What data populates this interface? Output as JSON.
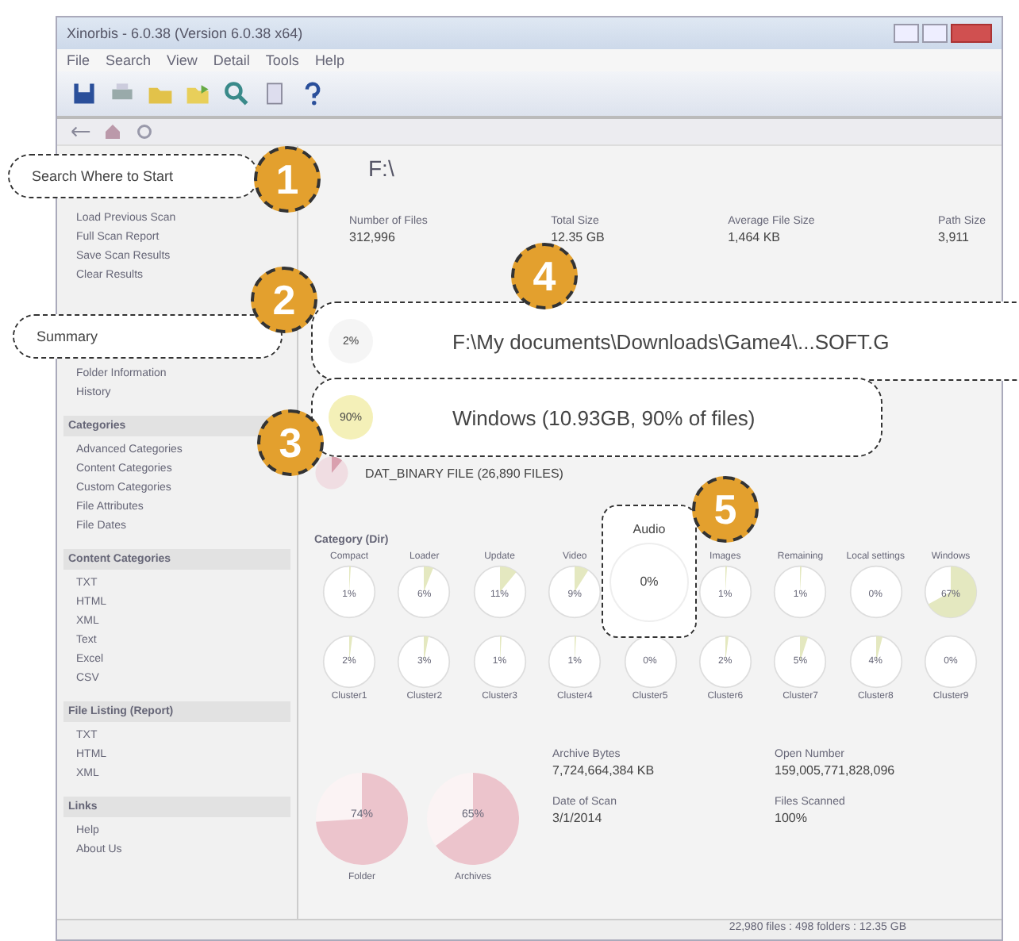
{
  "window": {
    "title": "Xinorbis - 6.0.38 (Version 6.0.38 x64)"
  },
  "menu": [
    "File",
    "Search",
    "View",
    "Detail",
    "Tools",
    "Help"
  ],
  "sidebar": {
    "sections": [
      {
        "items": [
          "Load Previous Scan",
          "Full Scan Report",
          "Save Scan Results",
          "Clear Results"
        ]
      },
      {
        "items": [
          "Folder Information",
          "History"
        ]
      },
      {
        "title": "Categories",
        "items": [
          "Advanced Categories",
          "Content Categories",
          "Custom Categories",
          "File Attributes",
          "File Dates"
        ]
      },
      {
        "title": "Content Categories",
        "items": [
          "TXT",
          "HTML",
          "XML",
          "Text",
          "Excel",
          "CSV"
        ]
      },
      {
        "title": "File Listing (Report)",
        "items": [
          "TXT",
          "HTML",
          "XML"
        ]
      },
      {
        "title": "Links",
        "items": [
          "Help",
          "About Us"
        ]
      }
    ]
  },
  "main": {
    "title": "F:\\",
    "stats": [
      {
        "label": "Number of Files",
        "value": "312,996"
      },
      {
        "label": "Total Size",
        "value": "12.35 GB"
      },
      {
        "label": "Average File Size",
        "value": "1,464 KB"
      },
      {
        "label": "Path Size",
        "value": "3,911"
      }
    ],
    "extension": {
      "value": "DAT_BINARY FILE (26,890 FILES)"
    },
    "category_title": "Category (Dir)",
    "category_row": [
      {
        "name": "Compact",
        "reading": "1%"
      },
      {
        "name": "Loader",
        "reading": "6%"
      },
      {
        "name": "Update",
        "reading": "11%"
      },
      {
        "name": "Video",
        "reading": "9%"
      },
      {
        "name": "Images",
        "reading": "1%"
      },
      {
        "name": "Remaining",
        "reading": "1%"
      },
      {
        "name": "Local settings",
        "reading": "0%"
      },
      {
        "name": "Windows",
        "reading": "67%"
      }
    ],
    "cluster_row": [
      {
        "name": "Cluster1",
        "reading": "2%"
      },
      {
        "name": "Cluster2",
        "reading": "3%"
      },
      {
        "name": "Cluster3",
        "reading": "1%"
      },
      {
        "name": "Cluster4",
        "reading": "1%"
      },
      {
        "name": "Cluster5",
        "reading": "0%"
      },
      {
        "name": "Cluster6",
        "reading": "2%"
      },
      {
        "name": "Cluster7",
        "reading": "5%"
      },
      {
        "name": "Cluster8",
        "reading": "4%"
      },
      {
        "name": "Cluster9",
        "reading": "0%"
      }
    ],
    "pies": [
      {
        "name": "Folder",
        "reading": "74%"
      },
      {
        "name": "Archives",
        "reading": "65%"
      }
    ],
    "details": [
      {
        "label": "Archive Bytes",
        "value": "7,724,664,384 KB"
      },
      {
        "label": "Open Number",
        "value": "159,005,771,828,096"
      },
      {
        "label": "Date of Scan",
        "value": "3/1/2014"
      },
      {
        "label": "Files Scanned",
        "value": "100%"
      }
    ]
  },
  "status_bar": "22,980 files : 498 folders : 12.35 GB",
  "callouts": [
    {
      "number": "1",
      "text": "Search Where to Start"
    },
    {
      "number": "2",
      "text": "Summary"
    },
    {
      "number": "4",
      "text": "F:\\My documents\\Downloads\\Game4\\...SOFT.G",
      "reading": "2%"
    },
    {
      "number": "3",
      "text": "Windows (10.93GB, 90% of files)",
      "reading": "90%"
    },
    {
      "number": "5",
      "text": "Audio",
      "reading": "0%"
    }
  ]
}
